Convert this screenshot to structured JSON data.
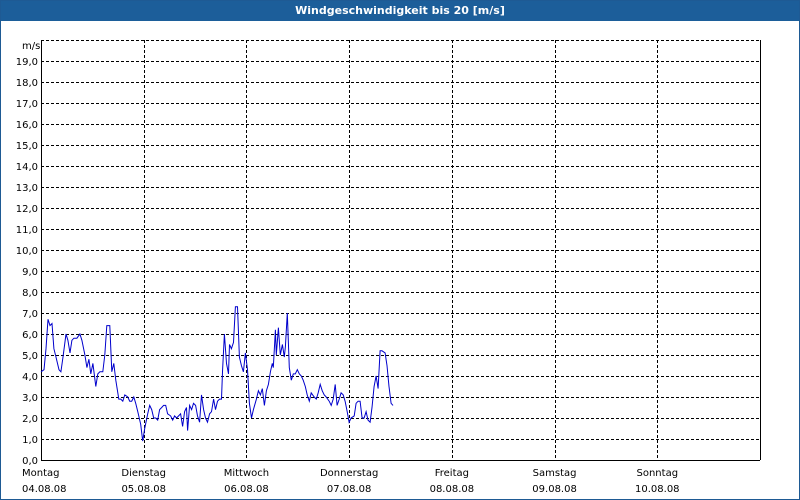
{
  "window": {
    "title": "Windgeschwindigkeit bis 20 [m/s]"
  },
  "chart_data": {
    "type": "line",
    "title": "Windgeschwindigkeit bis 20 [m/s]",
    "ylabel": "m/s",
    "xlabel": "",
    "ylim": [
      0,
      20
    ],
    "xlim": [
      0,
      7
    ],
    "grid": true,
    "yticks": [
      "0,0",
      "1,0",
      "2,0",
      "3,0",
      "4,0",
      "5,0",
      "6,0",
      "7,0",
      "8,0",
      "9,0",
      "10,0",
      "11,0",
      "12,0",
      "13,0",
      "14,0",
      "15,0",
      "16,0",
      "17,0",
      "18,0",
      "19,0"
    ],
    "xticks": [
      {
        "day": "Montag",
        "date": "04.08.08"
      },
      {
        "day": "Dienstag",
        "date": "05.08.08"
      },
      {
        "day": "Mittwoch",
        "date": "06.08.08"
      },
      {
        "day": "Donnerstag",
        "date": "07.08.08"
      },
      {
        "day": "Freitag",
        "date": "08.08.08"
      },
      {
        "day": "Samstag",
        "date": "09.08.08"
      },
      {
        "day": "Sonntag",
        "date": "10.08.08"
      }
    ],
    "line_color": "#0000cc",
    "grid_color": "#000000",
    "series": [
      {
        "points": [
          [
            0.0,
            4.2
          ],
          [
            0.029,
            4.3
          ],
          [
            0.049,
            5.3
          ],
          [
            0.068,
            6.7
          ],
          [
            0.088,
            6.4
          ],
          [
            0.107,
            6.5
          ],
          [
            0.126,
            5.3
          ],
          [
            0.146,
            4.9
          ],
          [
            0.175,
            4.3
          ],
          [
            0.194,
            4.2
          ],
          [
            0.214,
            4.9
          ],
          [
            0.243,
            6.0
          ],
          [
            0.262,
            5.7
          ],
          [
            0.282,
            5.1
          ],
          [
            0.301,
            5.7
          ],
          [
            0.32,
            5.8
          ],
          [
            0.35,
            5.8
          ],
          [
            0.379,
            6.0
          ],
          [
            0.398,
            5.7
          ],
          [
            0.427,
            5.0
          ],
          [
            0.447,
            4.4
          ],
          [
            0.466,
            4.8
          ],
          [
            0.485,
            4.1
          ],
          [
            0.505,
            4.6
          ],
          [
            0.534,
            3.5
          ],
          [
            0.553,
            4.1
          ],
          [
            0.573,
            4.2
          ],
          [
            0.602,
            4.2
          ],
          [
            0.621,
            5.0
          ],
          [
            0.641,
            6.4
          ],
          [
            0.67,
            6.4
          ],
          [
            0.689,
            4.2
          ],
          [
            0.709,
            4.6
          ],
          [
            0.728,
            3.8
          ],
          [
            0.757,
            2.9
          ],
          [
            0.777,
            2.9
          ],
          [
            0.796,
            2.8
          ],
          [
            0.816,
            3.1
          ],
          [
            0.845,
            3.0
          ],
          [
            0.864,
            2.8
          ],
          [
            0.883,
            2.8
          ],
          [
            0.903,
            3.0
          ],
          [
            0.922,
            2.7
          ],
          [
            0.942,
            2.3
          ],
          [
            0.971,
            1.7
          ],
          [
            0.99,
            0.9
          ],
          [
            1.01,
            1.5
          ],
          [
            1.039,
            2.2
          ],
          [
            1.058,
            2.6
          ],
          [
            1.078,
            2.4
          ],
          [
            1.097,
            2.0
          ],
          [
            1.117,
            2.0
          ],
          [
            1.136,
            1.9
          ],
          [
            1.155,
            2.4
          ],
          [
            1.175,
            2.5
          ],
          [
            1.194,
            2.6
          ],
          [
            1.214,
            2.6
          ],
          [
            1.233,
            2.2
          ],
          [
            1.262,
            2.1
          ],
          [
            1.282,
            1.9
          ],
          [
            1.301,
            2.1
          ],
          [
            1.32,
            2.0
          ],
          [
            1.34,
            2.1
          ],
          [
            1.359,
            2.2
          ],
          [
            1.379,
            1.6
          ],
          [
            1.398,
            2.3
          ],
          [
            1.417,
            2.5
          ],
          [
            1.427,
            1.4
          ],
          [
            1.447,
            2.6
          ],
          [
            1.466,
            2.4
          ],
          [
            1.485,
            2.7
          ],
          [
            1.505,
            2.6
          ],
          [
            1.524,
            2.1
          ],
          [
            1.544,
            1.8
          ],
          [
            1.563,
            3.1
          ],
          [
            1.583,
            2.4
          ],
          [
            1.602,
            2.0
          ],
          [
            1.621,
            1.8
          ],
          [
            1.641,
            2.2
          ],
          [
            1.66,
            2.3
          ],
          [
            1.68,
            2.9
          ],
          [
            1.699,
            2.4
          ],
          [
            1.718,
            2.8
          ],
          [
            1.738,
            2.9
          ],
          [
            1.757,
            2.9
          ],
          [
            1.767,
            4.2
          ],
          [
            1.786,
            6.0
          ],
          [
            1.806,
            4.6
          ],
          [
            1.825,
            4.1
          ],
          [
            1.835,
            5.5
          ],
          [
            1.854,
            5.3
          ],
          [
            1.874,
            5.6
          ],
          [
            1.893,
            7.3
          ],
          [
            1.913,
            7.3
          ],
          [
            1.932,
            4.9
          ],
          [
            1.951,
            4.5
          ],
          [
            1.971,
            4.2
          ],
          [
            1.99,
            5.1
          ],
          [
            2.01,
            4.3
          ],
          [
            2.029,
            2.7
          ],
          [
            2.049,
            2.0
          ],
          [
            2.068,
            2.4
          ],
          [
            2.097,
            2.9
          ],
          [
            2.117,
            3.3
          ],
          [
            2.136,
            3.1
          ],
          [
            2.155,
            3.4
          ],
          [
            2.175,
            2.6
          ],
          [
            2.194,
            3.3
          ],
          [
            2.214,
            3.6
          ],
          [
            2.233,
            4.2
          ],
          [
            2.252,
            4.6
          ],
          [
            2.262,
            4.4
          ],
          [
            2.282,
            6.2
          ],
          [
            2.291,
            5.0
          ],
          [
            2.311,
            6.3
          ],
          [
            2.33,
            5.0
          ],
          [
            2.35,
            5.5
          ],
          [
            2.369,
            4.9
          ],
          [
            2.379,
            5.4
          ],
          [
            2.398,
            7.0
          ],
          [
            2.417,
            4.4
          ],
          [
            2.437,
            3.8
          ],
          [
            2.456,
            4.1
          ],
          [
            2.476,
            4.1
          ],
          [
            2.495,
            4.3
          ],
          [
            2.515,
            4.1
          ],
          [
            2.534,
            4.0
          ],
          [
            2.553,
            3.8
          ],
          [
            2.573,
            3.5
          ],
          [
            2.592,
            3.1
          ],
          [
            2.612,
            2.8
          ],
          [
            2.631,
            3.2
          ],
          [
            2.66,
            3.0
          ],
          [
            2.68,
            2.9
          ],
          [
            2.699,
            3.2
          ],
          [
            2.718,
            3.6
          ],
          [
            2.738,
            3.3
          ],
          [
            2.757,
            3.1
          ],
          [
            2.777,
            3.0
          ],
          [
            2.806,
            2.8
          ],
          [
            2.825,
            2.6
          ],
          [
            2.845,
            2.9
          ],
          [
            2.864,
            3.6
          ],
          [
            2.883,
            2.6
          ],
          [
            2.903,
            2.9
          ],
          [
            2.922,
            3.2
          ],
          [
            2.942,
            3.1
          ],
          [
            2.961,
            2.8
          ],
          [
            2.981,
            2.3
          ],
          [
            3.0,
            1.8
          ],
          [
            3.019,
            2.0
          ],
          [
            3.049,
            2.1
          ],
          [
            3.068,
            2.7
          ],
          [
            3.087,
            2.8
          ],
          [
            3.107,
            2.8
          ],
          [
            3.126,
            2.0
          ],
          [
            3.146,
            2.0
          ],
          [
            3.165,
            2.3
          ],
          [
            3.184,
            1.9
          ],
          [
            3.204,
            1.8
          ],
          [
            3.223,
            2.5
          ],
          [
            3.243,
            3.5
          ],
          [
            3.262,
            4.0
          ],
          [
            3.282,
            3.4
          ],
          [
            3.301,
            5.2
          ],
          [
            3.32,
            5.2
          ],
          [
            3.35,
            5.1
          ],
          [
            3.369,
            4.5
          ],
          [
            3.388,
            3.5
          ],
          [
            3.408,
            2.7
          ],
          [
            3.427,
            2.6
          ]
        ]
      }
    ]
  }
}
